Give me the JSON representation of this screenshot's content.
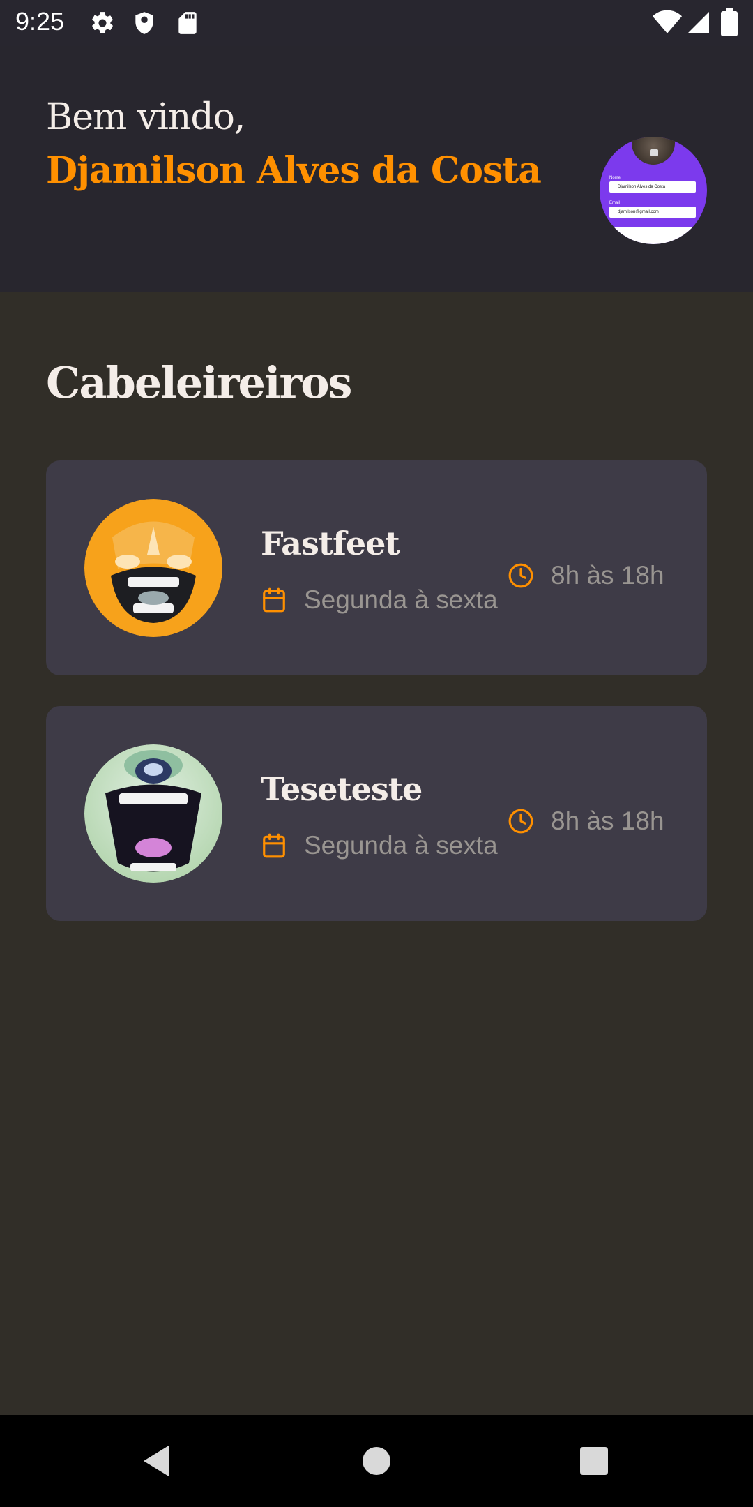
{
  "status_bar": {
    "time": "9:25",
    "icons": [
      "settings-icon",
      "shield-icon",
      "sd-card-icon",
      "wifi-icon",
      "signal-icon",
      "battery-icon"
    ]
  },
  "header": {
    "welcome": "Bem vindo,",
    "user_name": "Djamilson Alves da Costa",
    "avatar_preview": {
      "label_name": "Nome",
      "field_name": "Djamilson Alves da Costa",
      "label_email": "Email",
      "field_email": "djamilson@gmail.com"
    }
  },
  "section": {
    "title": "Cabeleireiros"
  },
  "providers": [
    {
      "name": "Fastfeet",
      "days": "Segunda à sexta",
      "hours": "8h às 18h",
      "avatar_icon": "orange-laughing-face-avatar"
    },
    {
      "name": "Teseteste",
      "days": "Segunda à sexta",
      "hours": "8h às 18h",
      "avatar_icon": "green-screaming-face-avatar"
    }
  ],
  "colors": {
    "accent": "#ff9000",
    "header_bg": "#28262e",
    "page_bg": "#312e28",
    "card_bg": "#3e3b47",
    "text_primary": "#f4ede8",
    "text_secondary": "#999591"
  },
  "nav_bar": {
    "buttons": [
      "back-icon",
      "home-icon",
      "recents-icon"
    ]
  }
}
